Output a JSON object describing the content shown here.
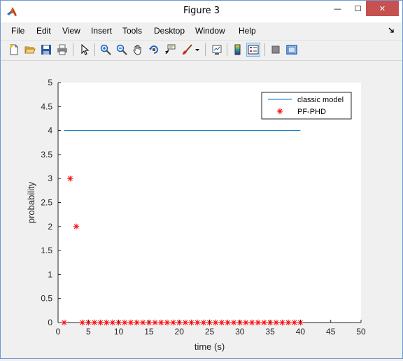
{
  "window": {
    "title": "Figure 3",
    "controls": {
      "minimize": "—",
      "maximize": "☐",
      "close": "✕"
    },
    "close_color": "#c75050",
    "border_color": "#6f9ad2"
  },
  "menubar": {
    "items": [
      {
        "label": "File",
        "name": "menu-file"
      },
      {
        "label": "Edit",
        "name": "menu-edit"
      },
      {
        "label": "View",
        "name": "menu-view"
      },
      {
        "label": "Insert",
        "name": "menu-insert"
      },
      {
        "label": "Tools",
        "name": "menu-tools"
      },
      {
        "label": "Desktop",
        "name": "menu-desktop"
      },
      {
        "label": "Window",
        "name": "menu-window"
      },
      {
        "label": "Help",
        "name": "menu-help"
      }
    ],
    "dock_icon": "dock-arrow-icon"
  },
  "toolbar": {
    "buttons": [
      {
        "icon": "new-figure-icon"
      },
      {
        "icon": "open-file-icon"
      },
      {
        "icon": "save-figure-icon"
      },
      {
        "icon": "print-figure-icon"
      },
      {
        "icon": "edit-plot-arrow-icon"
      },
      {
        "icon": "zoom-in-icon"
      },
      {
        "icon": "zoom-out-icon"
      },
      {
        "icon": "pan-hand-icon"
      },
      {
        "icon": "rotate-3d-icon"
      },
      {
        "icon": "data-cursor-icon"
      },
      {
        "icon": "brush-icon"
      },
      {
        "icon": "brush-dropdown-icon"
      },
      {
        "icon": "link-plot-icon"
      },
      {
        "icon": "insert-colorbar-icon"
      },
      {
        "icon": "insert-legend-icon",
        "active": true
      },
      {
        "icon": "hide-plot-tools-icon"
      },
      {
        "icon": "show-plot-tools-icon"
      }
    ]
  },
  "chart_data": {
    "type": "line",
    "xlabel": "time (s)",
    "ylabel": "probability",
    "xlim": [
      0,
      50
    ],
    "ylim": [
      0,
      5
    ],
    "xticks": [
      0,
      5,
      10,
      15,
      20,
      25,
      30,
      35,
      40,
      45,
      50
    ],
    "yticks": [
      0,
      0.5,
      1,
      1.5,
      2,
      2.5,
      3,
      3.5,
      4,
      4.5,
      5
    ],
    "ytick_labels": [
      "0",
      "0.5",
      "1",
      "1.5",
      "2",
      "2.5",
      "3",
      "3.5",
      "4",
      "4.5",
      "5"
    ],
    "grid": false,
    "legend_position": "top-right",
    "series": [
      {
        "name": "classic model",
        "style": "line",
        "color": "#0072bd",
        "x": [
          1,
          40
        ],
        "y": [
          4,
          4
        ]
      },
      {
        "name": "PF-PHD",
        "style": "marker-asterisk",
        "color": "#ff0000",
        "x": [
          1,
          2,
          3,
          4,
          5,
          6,
          7,
          8,
          9,
          10,
          11,
          12,
          13,
          14,
          15,
          16,
          17,
          18,
          19,
          20,
          21,
          22,
          23,
          24,
          25,
          26,
          27,
          28,
          29,
          30,
          31,
          32,
          33,
          34,
          35,
          36,
          37,
          38,
          39,
          40
        ],
        "y": [
          0,
          3,
          2,
          0,
          0,
          0,
          0,
          0,
          0,
          0,
          0,
          0,
          0,
          0,
          0,
          0,
          0,
          0,
          0,
          0,
          0,
          0,
          0,
          0,
          0,
          0,
          0,
          0,
          0,
          0,
          0,
          0,
          0,
          0,
          0,
          0,
          0,
          0,
          0,
          0
        ]
      }
    ]
  }
}
